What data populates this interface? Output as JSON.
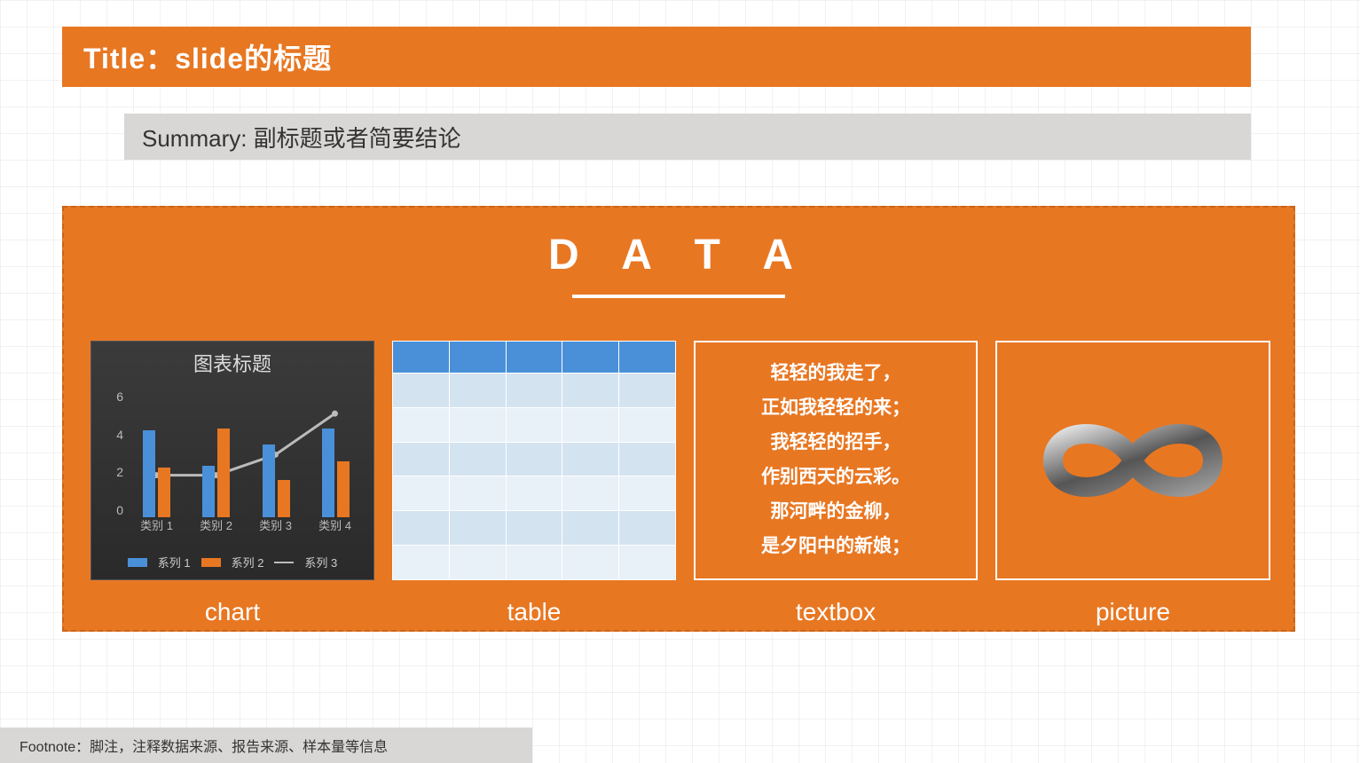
{
  "title": "Title：slide的标题",
  "summary": "Summary: 副标题或者简要结论",
  "data_heading": "D A T A",
  "labels": {
    "chart": "chart",
    "table": "table",
    "textbox": "textbox",
    "picture": "picture"
  },
  "textbox_lines": [
    "轻轻的我走了，",
    "正如我轻轻的来；",
    "我轻轻的招手，",
    "作别西天的云彩。",
    "那河畔的金柳，",
    "是夕阳中的新娘；"
  ],
  "chart_data": {
    "type": "bar+line",
    "title": "图表标题",
    "categories": [
      "类别 1",
      "类别 2",
      "类别 3",
      "类别 4"
    ],
    "y_ticks": [
      0,
      2,
      4,
      6
    ],
    "ylim": [
      0,
      6
    ],
    "series": [
      {
        "name": "系列 1",
        "type": "bar",
        "color": "#4A90D9",
        "values": [
          4.2,
          2.5,
          3.5,
          4.3
        ]
      },
      {
        "name": "系列 2",
        "type": "bar",
        "color": "#E87722",
        "values": [
          2.4,
          4.3,
          1.8,
          2.7
        ]
      },
      {
        "name": "系列 3",
        "type": "line",
        "color": "#BBBBBB",
        "values": [
          2.0,
          2.0,
          3.0,
          5.0
        ]
      }
    ]
  },
  "table": {
    "cols": 5,
    "rows": 7
  },
  "footnote": "Footnote：脚注，注释数据来源、报告来源、样本量等信息"
}
